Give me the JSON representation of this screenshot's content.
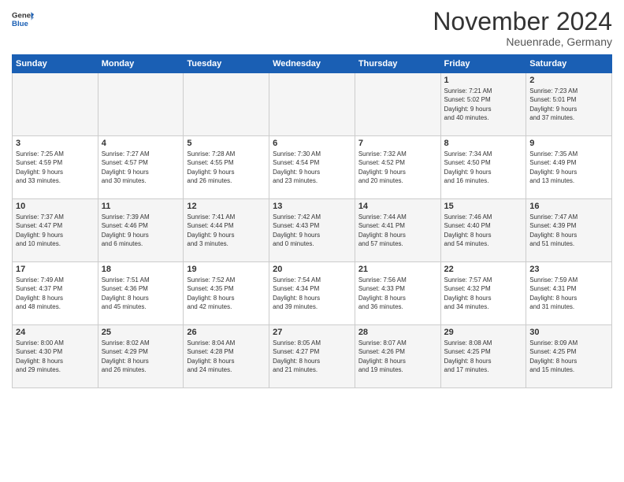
{
  "header": {
    "logo_general": "General",
    "logo_blue": "Blue",
    "month_title": "November 2024",
    "location": "Neuenrade, Germany"
  },
  "weekdays": [
    "Sunday",
    "Monday",
    "Tuesday",
    "Wednesday",
    "Thursday",
    "Friday",
    "Saturday"
  ],
  "weeks": [
    [
      {
        "day": "",
        "info": ""
      },
      {
        "day": "",
        "info": ""
      },
      {
        "day": "",
        "info": ""
      },
      {
        "day": "",
        "info": ""
      },
      {
        "day": "",
        "info": ""
      },
      {
        "day": "1",
        "info": "Sunrise: 7:21 AM\nSunset: 5:02 PM\nDaylight: 9 hours\nand 40 minutes."
      },
      {
        "day": "2",
        "info": "Sunrise: 7:23 AM\nSunset: 5:01 PM\nDaylight: 9 hours\nand 37 minutes."
      }
    ],
    [
      {
        "day": "3",
        "info": "Sunrise: 7:25 AM\nSunset: 4:59 PM\nDaylight: 9 hours\nand 33 minutes."
      },
      {
        "day": "4",
        "info": "Sunrise: 7:27 AM\nSunset: 4:57 PM\nDaylight: 9 hours\nand 30 minutes."
      },
      {
        "day": "5",
        "info": "Sunrise: 7:28 AM\nSunset: 4:55 PM\nDaylight: 9 hours\nand 26 minutes."
      },
      {
        "day": "6",
        "info": "Sunrise: 7:30 AM\nSunset: 4:54 PM\nDaylight: 9 hours\nand 23 minutes."
      },
      {
        "day": "7",
        "info": "Sunrise: 7:32 AM\nSunset: 4:52 PM\nDaylight: 9 hours\nand 20 minutes."
      },
      {
        "day": "8",
        "info": "Sunrise: 7:34 AM\nSunset: 4:50 PM\nDaylight: 9 hours\nand 16 minutes."
      },
      {
        "day": "9",
        "info": "Sunrise: 7:35 AM\nSunset: 4:49 PM\nDaylight: 9 hours\nand 13 minutes."
      }
    ],
    [
      {
        "day": "10",
        "info": "Sunrise: 7:37 AM\nSunset: 4:47 PM\nDaylight: 9 hours\nand 10 minutes."
      },
      {
        "day": "11",
        "info": "Sunrise: 7:39 AM\nSunset: 4:46 PM\nDaylight: 9 hours\nand 6 minutes."
      },
      {
        "day": "12",
        "info": "Sunrise: 7:41 AM\nSunset: 4:44 PM\nDaylight: 9 hours\nand 3 minutes."
      },
      {
        "day": "13",
        "info": "Sunrise: 7:42 AM\nSunset: 4:43 PM\nDaylight: 9 hours\nand 0 minutes."
      },
      {
        "day": "14",
        "info": "Sunrise: 7:44 AM\nSunset: 4:41 PM\nDaylight: 8 hours\nand 57 minutes."
      },
      {
        "day": "15",
        "info": "Sunrise: 7:46 AM\nSunset: 4:40 PM\nDaylight: 8 hours\nand 54 minutes."
      },
      {
        "day": "16",
        "info": "Sunrise: 7:47 AM\nSunset: 4:39 PM\nDaylight: 8 hours\nand 51 minutes."
      }
    ],
    [
      {
        "day": "17",
        "info": "Sunrise: 7:49 AM\nSunset: 4:37 PM\nDaylight: 8 hours\nand 48 minutes."
      },
      {
        "day": "18",
        "info": "Sunrise: 7:51 AM\nSunset: 4:36 PM\nDaylight: 8 hours\nand 45 minutes."
      },
      {
        "day": "19",
        "info": "Sunrise: 7:52 AM\nSunset: 4:35 PM\nDaylight: 8 hours\nand 42 minutes."
      },
      {
        "day": "20",
        "info": "Sunrise: 7:54 AM\nSunset: 4:34 PM\nDaylight: 8 hours\nand 39 minutes."
      },
      {
        "day": "21",
        "info": "Sunrise: 7:56 AM\nSunset: 4:33 PM\nDaylight: 8 hours\nand 36 minutes."
      },
      {
        "day": "22",
        "info": "Sunrise: 7:57 AM\nSunset: 4:32 PM\nDaylight: 8 hours\nand 34 minutes."
      },
      {
        "day": "23",
        "info": "Sunrise: 7:59 AM\nSunset: 4:31 PM\nDaylight: 8 hours\nand 31 minutes."
      }
    ],
    [
      {
        "day": "24",
        "info": "Sunrise: 8:00 AM\nSunset: 4:30 PM\nDaylight: 8 hours\nand 29 minutes."
      },
      {
        "day": "25",
        "info": "Sunrise: 8:02 AM\nSunset: 4:29 PM\nDaylight: 8 hours\nand 26 minutes."
      },
      {
        "day": "26",
        "info": "Sunrise: 8:04 AM\nSunset: 4:28 PM\nDaylight: 8 hours\nand 24 minutes."
      },
      {
        "day": "27",
        "info": "Sunrise: 8:05 AM\nSunset: 4:27 PM\nDaylight: 8 hours\nand 21 minutes."
      },
      {
        "day": "28",
        "info": "Sunrise: 8:07 AM\nSunset: 4:26 PM\nDaylight: 8 hours\nand 19 minutes."
      },
      {
        "day": "29",
        "info": "Sunrise: 8:08 AM\nSunset: 4:25 PM\nDaylight: 8 hours\nand 17 minutes."
      },
      {
        "day": "30",
        "info": "Sunrise: 8:09 AM\nSunset: 4:25 PM\nDaylight: 8 hours\nand 15 minutes."
      }
    ]
  ]
}
